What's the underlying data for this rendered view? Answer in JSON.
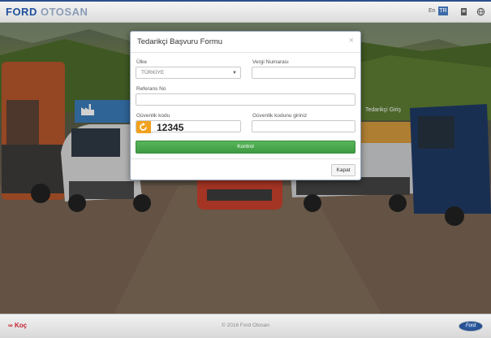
{
  "header": {
    "logo_main": "FORD",
    "logo_secondary": "OTOSAN",
    "lang_en": "En",
    "lang_tr": "TR",
    "icons": [
      "document-icon",
      "globe-icon"
    ]
  },
  "background": {
    "left_button_icon": "factory-icon",
    "right_button_label": "Tedarikçi Giriş"
  },
  "modal": {
    "title": "Tedarikçi Başvuru Formu",
    "close_glyph": "×",
    "country_label": "Ülke",
    "country_value": "TÜRKİYE",
    "tax_label": "Vergi Numarası",
    "tax_value": "",
    "reference_label": "Referans No",
    "reference_value": "",
    "security_code_label": "Güvenlik kodu",
    "security_code_value": "12345",
    "security_input_label": "Güvenlik kodunu giriniz",
    "security_input_value": "",
    "control_button": "Kontrol",
    "close_button": "Kapat"
  },
  "footer": {
    "brand": "Koç",
    "copyright": "© 2016 Ford Otosan",
    "ford_badge": "Ford"
  },
  "colors": {
    "brand_blue": "#1f4f9c",
    "accent_orange": "#f0a21f",
    "button_green": "#4caf50",
    "koc_red": "#c4222f"
  }
}
